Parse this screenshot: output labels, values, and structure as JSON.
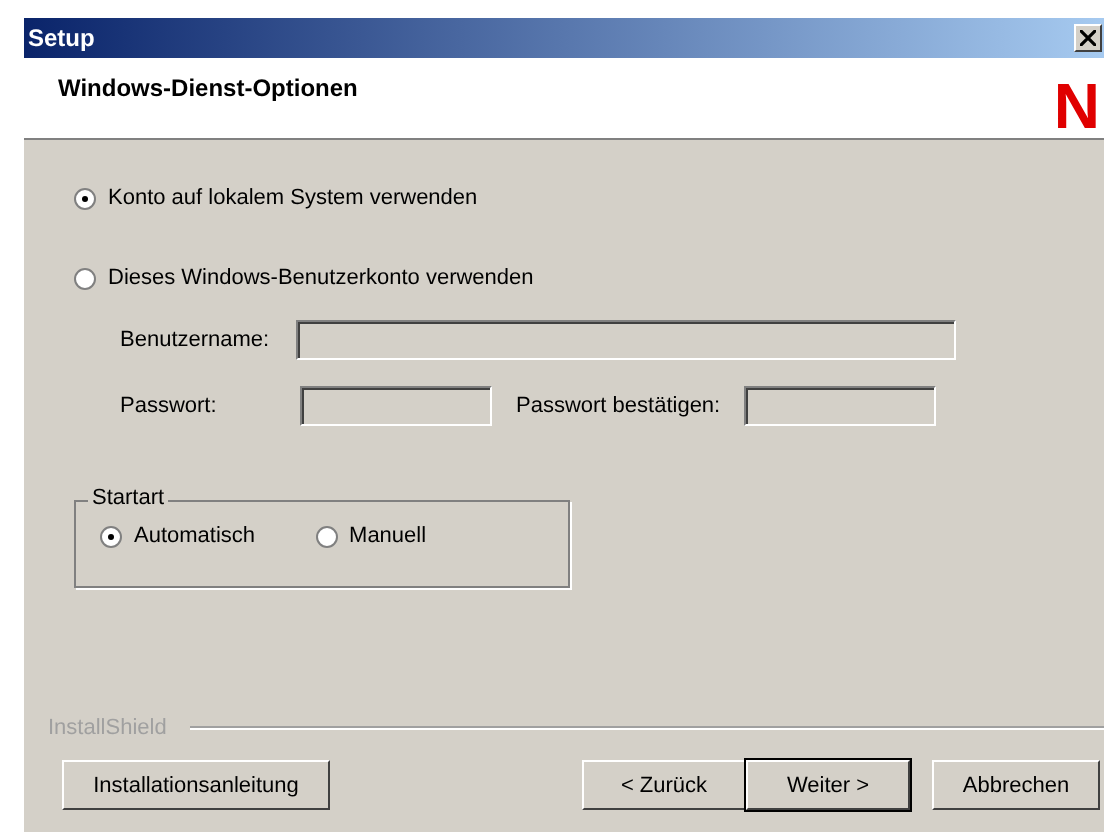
{
  "window": {
    "title": "Setup"
  },
  "header": {
    "title": "Windows-Dienst-Optionen",
    "logo": "N"
  },
  "account_options": [
    {
      "label": "Konto auf lokalem System verwenden",
      "selected": true
    },
    {
      "label": "Dieses Windows-Benutzerkonto verwenden",
      "selected": false
    }
  ],
  "fields": {
    "username": {
      "label": "Benutzername:",
      "disabled": true
    },
    "password": {
      "label": "Passwort:",
      "disabled": true
    },
    "confirm": {
      "label": "Passwort bestätigen:",
      "disabled": true
    }
  },
  "start_type": {
    "title": "Startart",
    "options": [
      {
        "label": "Automatisch",
        "selected": true
      },
      {
        "label": "Manuell",
        "selected": false
      }
    ]
  },
  "brand": "InstallShield",
  "buttons": {
    "guide": "Installationsanleitung",
    "back": "< Zurück",
    "next": "Weiter >",
    "cancel": "Abbrechen"
  }
}
